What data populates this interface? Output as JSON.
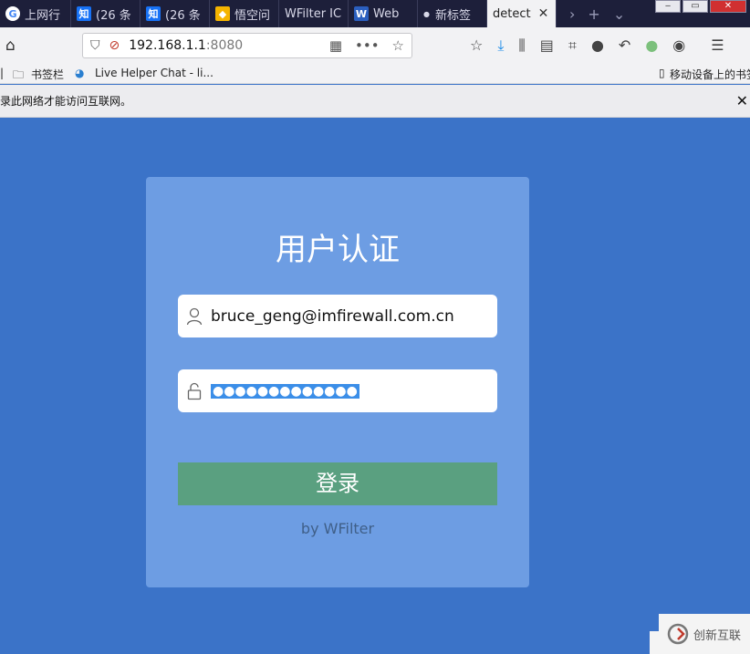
{
  "tabs": [
    {
      "label": "上网行",
      "icon": "google-icon",
      "color": "#ffffff"
    },
    {
      "label": "(26 条",
      "icon": "zhihu-icon",
      "color": "#1772f6"
    },
    {
      "label": "(26 条",
      "icon": "zhihu-icon",
      "color": "#1772f6"
    },
    {
      "label": "悟空问",
      "icon": "wukong-icon",
      "color": "#f5b400"
    },
    {
      "label": "WFilter IC",
      "icon": "",
      "color": ""
    },
    {
      "label": "Web",
      "icon": "word-icon",
      "color": "#2b5fbf"
    },
    {
      "label": "新标签",
      "icon": "dot-icon",
      "color": ""
    },
    {
      "label": "detect",
      "icon": "",
      "color": ""
    }
  ],
  "url": {
    "host": "192.168.1.1",
    "port": ":8080"
  },
  "bookmarks": {
    "folder": "书签栏",
    "live": "Live Helper Chat - li...",
    "mobile": "移动设备上的书签"
  },
  "notice": "录此网络才能访问互联网。",
  "login": {
    "title": "用户认证",
    "username": "bruce_geng@imfirewall.com.cn",
    "password": "●●●●●●●●●●●●●",
    "submit": "登录",
    "footer": "by WFilter"
  },
  "watermark": "创新互联",
  "colors": {
    "background": "#3b73c8",
    "card": "#6d9de3",
    "button": "#5aa080"
  }
}
